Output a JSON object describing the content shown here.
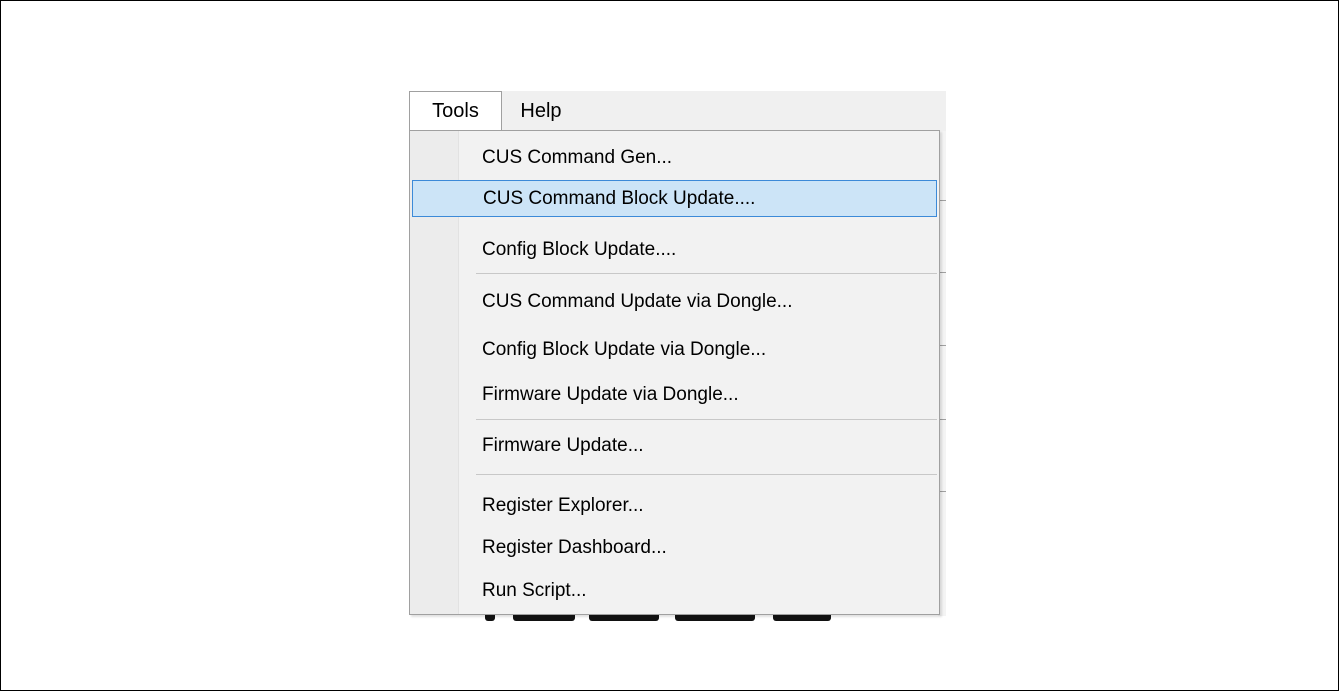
{
  "menubar": {
    "items": [
      {
        "label": "Tools"
      },
      {
        "label": "Help"
      }
    ]
  },
  "tools_menu": {
    "items": [
      {
        "label": "CUS Command Gen..."
      },
      {
        "label": "CUS Command Block Update...."
      },
      {
        "label": "Config Block Update...."
      },
      {
        "label": "CUS Command Update via Dongle..."
      },
      {
        "label": "Config Block Update via Dongle..."
      },
      {
        "label": "Firmware Update via Dongle..."
      },
      {
        "label": "Firmware Update..."
      },
      {
        "label": "Register Explorer..."
      },
      {
        "label": "Register Dashboard..."
      },
      {
        "label": "Run Script..."
      }
    ],
    "highlighted_index": 1
  },
  "colors": {
    "highlight_fill": "#cce4f7",
    "highlight_border": "#3c8ad8",
    "menu_background": "#f2f2f2"
  }
}
